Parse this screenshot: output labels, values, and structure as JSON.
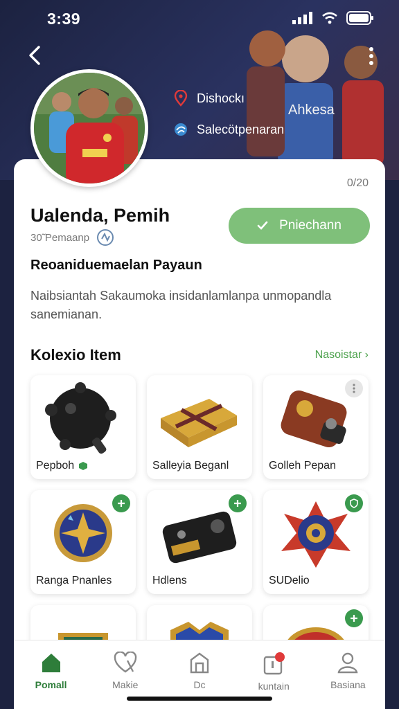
{
  "status_bar": {
    "time": "3:39"
  },
  "header": {
    "info_items": [
      {
        "icon": "location-pin-icon",
        "label": "Dishockı"
      },
      {
        "icon": "globe-icon",
        "label": "Salecötpenaran"
      }
    ]
  },
  "profile": {
    "count": "0/20",
    "name": "Ualenda, Pemih",
    "subtitle": "30̃ Pemaanp",
    "follow_label": "Pniechann",
    "heading": "Reoaniduemaelan Payaun",
    "description": "Naibsiantah Sakaumoka insidanlamlanpa unmopandla sanemianan."
  },
  "collection": {
    "title": "Kolexio Item",
    "see_all": "Nasoistar",
    "items": [
      {
        "label": "Pepboh",
        "image": "bomb-ball-icon",
        "badge": "none",
        "has_inline_badge": true
      },
      {
        "label": "Salleyia Beganl",
        "image": "gift-box-icon",
        "badge": "none"
      },
      {
        "label": "Golleh Pepan",
        "image": "leather-pouch-icon",
        "badge": "more"
      },
      {
        "label": "Ranga Pnanles",
        "image": "star-medal-icon",
        "badge": "add"
      },
      {
        "label": "Hdlens",
        "image": "camera-device-icon",
        "badge": "add"
      },
      {
        "label": "SUDelio",
        "image": "star-emblem-icon",
        "badge": "shield"
      },
      {
        "label": "",
        "image": "shield-crest-icon",
        "badge": "none"
      },
      {
        "label": "",
        "image": "blue-shield-icon",
        "badge": "none"
      },
      {
        "label": "",
        "image": "red-emblem-icon",
        "badge": "add"
      }
    ]
  },
  "bottom_nav": [
    {
      "label": "Pomall",
      "icon": "home-icon",
      "active": true
    },
    {
      "label": "Makie",
      "icon": "heart-icon",
      "active": false
    },
    {
      "label": "Dc",
      "icon": "house-outline-icon",
      "active": false
    },
    {
      "label": "kuntain",
      "icon": "notification-icon",
      "active": false
    },
    {
      "label": "Basiana",
      "icon": "profile-icon",
      "active": false
    }
  ],
  "colors": {
    "accent_green": "#7fc07a",
    "dark_green": "#2e7d3a",
    "header_bg": "#1c2240"
  }
}
